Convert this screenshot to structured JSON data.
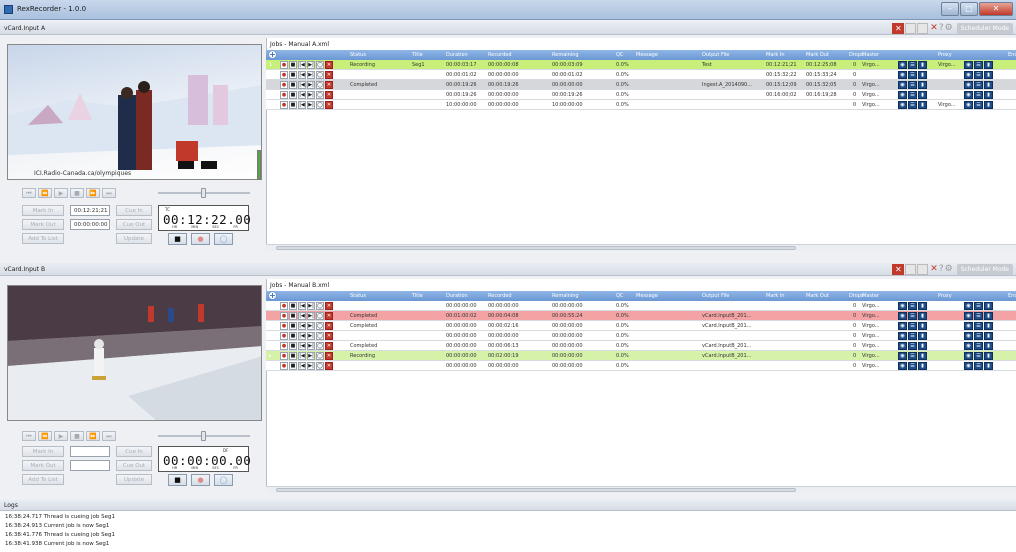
{
  "window": {
    "title": "RexRecorder - 1.0.0"
  },
  "panels": [
    {
      "header": "vCard.Input A",
      "scheduler_label": "Scheduler Mode",
      "preview_caption": "ICI.Radio-Canada.ca/olympiques",
      "transport": [
        "⏮",
        "⏪",
        "▶",
        "■",
        "⏩",
        "⏭"
      ],
      "mark_in_label": "Mark In",
      "mark_in_value": "00:12:21;21",
      "mark_out_label": "Mark Out",
      "mark_out_value": "00:00:00:00",
      "cue_in_label": "Cue In",
      "cue_out_label": "Cue Out",
      "add_to_list_label": "Add To List",
      "update_label": "Update",
      "timecode_tag": "TC",
      "timecode": "00:12:22.00",
      "timecode_units": [
        "HR",
        "MIN",
        "SEC",
        "FR"
      ],
      "jobs_title": "Jobs - Manual A.xml",
      "columns": [
        "Status",
        "Title",
        "Duration",
        "Recorded",
        "Remaining",
        "QC",
        "Message",
        "Output File",
        "Mark In",
        "Mark Out",
        "Drops",
        "Master",
        "Proxy",
        "Enc"
      ],
      "rows": [
        {
          "idx": "1",
          "status": "Recording",
          "title": "Seg1",
          "duration": "00:00:03:17",
          "recorded": "00:00:00:08",
          "remaining": "00:00:03:09",
          "qc": "0.0%",
          "message": "",
          "output": "Test",
          "mark_in": "00:12:21;21",
          "mark_out": "00:12:25;08",
          "drops": "0",
          "master": "Virgo...",
          "proxy": "Virgo...",
          "bg": "#c8ef7a"
        },
        {
          "idx": "",
          "status": "",
          "title": "",
          "duration": "00:00:01:02",
          "recorded": "00:00:00:00",
          "remaining": "00:00:01:02",
          "qc": "0.0%",
          "message": "",
          "output": "",
          "mark_in": "00:15:32;22",
          "mark_out": "00:15:33;24",
          "drops": "0",
          "master": "",
          "proxy": "",
          "bg": "#ffffff"
        },
        {
          "idx": "",
          "status": "Completed",
          "title": "",
          "duration": "00:00:19:26",
          "recorded": "00:00:19:26",
          "remaining": "00:00:00:00",
          "qc": "0.0%",
          "message": "",
          "output": "Ingest.A_2014090...",
          "mark_in": "00:15:12;09",
          "mark_out": "00:15:32;05",
          "drops": "0",
          "master": "Virgo...",
          "proxy": "",
          "bg": "#d5d7da"
        },
        {
          "idx": "",
          "status": "",
          "title": "",
          "duration": "00:00:19:26",
          "recorded": "00:00:00:00",
          "remaining": "00:00:19:26",
          "qc": "0.0%",
          "message": "",
          "output": "",
          "mark_in": "00:16:00;02",
          "mark_out": "00:16:19;28",
          "drops": "0",
          "master": "Virgo...",
          "proxy": "",
          "bg": "#ffffff"
        },
        {
          "idx": "",
          "status": "",
          "title": "",
          "duration": "10:00:00:00",
          "recorded": "00:00:00:00",
          "remaining": "10:00:00:00",
          "qc": "0.0%",
          "message": "",
          "output": "",
          "mark_in": "",
          "mark_out": "",
          "drops": "0",
          "master": "Virgo...",
          "proxy": "Virgo...",
          "bg": "#ffffff"
        }
      ]
    },
    {
      "header": "vCard.Input B",
      "scheduler_label": "Scheduler Mode",
      "preview_caption": "",
      "transport": [
        "⏮",
        "⏪",
        "▶",
        "■",
        "⏩",
        "⏭"
      ],
      "mark_in_label": "Mark In",
      "mark_in_value": "",
      "mark_out_label": "Mark Out",
      "mark_out_value": "",
      "cue_in_label": "Cue In",
      "cue_out_label": "Cue Out",
      "add_to_list_label": "Add To List",
      "update_label": "Update",
      "timecode_tag": "DF",
      "timecode": "00:00:00.00",
      "timecode_units": [
        "HR",
        "MIN",
        "SEC",
        "FR"
      ],
      "jobs_title": "Jobs - Manual B.xml",
      "columns": [
        "Status",
        "Title",
        "Duration",
        "Recorded",
        "Remaining",
        "QC",
        "Message",
        "Output File",
        "Mark In",
        "Mark Out",
        "Drops",
        "Master",
        "Proxy",
        "Enc"
      ],
      "rows": [
        {
          "idx": "",
          "status": "",
          "title": "",
          "duration": "00:00:00:00",
          "recorded": "00:00:00:00",
          "remaining": "00:00:00:00",
          "qc": "0.0%",
          "message": "",
          "output": "",
          "mark_in": "",
          "mark_out": "",
          "drops": "0",
          "master": "Virgo...",
          "proxy": "",
          "bg": "#ffffff"
        },
        {
          "idx": "",
          "status": "Completed",
          "title": "",
          "duration": "00:01:00:02",
          "recorded": "00:00:04:08",
          "remaining": "00:00:55:24",
          "qc": "0.0%",
          "message": "",
          "output": "vCard.InputB_201...",
          "mark_in": "",
          "mark_out": "",
          "drops": "0",
          "master": "Virgo...",
          "proxy": "",
          "bg": "#f3a3a3"
        },
        {
          "idx": "",
          "status": "Completed",
          "title": "",
          "duration": "00:00:00:00",
          "recorded": "00:00:02:16",
          "remaining": "00:00:00:00",
          "qc": "0.0%",
          "message": "",
          "output": "vCard.InputB_201...",
          "mark_in": "",
          "mark_out": "",
          "drops": "0",
          "master": "Virgo...",
          "proxy": "",
          "bg": "#ffffff"
        },
        {
          "idx": "",
          "status": "",
          "title": "",
          "duration": "00:00:00:00",
          "recorded": "00:00:00:00",
          "remaining": "00:00:00:00",
          "qc": "0.0%",
          "message": "",
          "output": "",
          "mark_in": "",
          "mark_out": "",
          "drops": "0",
          "master": "Virgo...",
          "proxy": "",
          "bg": "#ffffff"
        },
        {
          "idx": "",
          "status": "Completed",
          "title": "",
          "duration": "00:00:00:00",
          "recorded": "00:00:06:13",
          "remaining": "00:00:00:00",
          "qc": "0.0%",
          "message": "",
          "output": "vCard.InputB_201...",
          "mark_in": "",
          "mark_out": "",
          "drops": "0",
          "master": "Virgo...",
          "proxy": "",
          "bg": "#ffffff"
        },
        {
          "idx": "▸",
          "status": "Recording",
          "title": "",
          "duration": "00:00:00:00",
          "recorded": "00:02:00:19",
          "remaining": "00:00:00:00",
          "qc": "0.0%",
          "message": "",
          "output": "vCard.InputB_201...",
          "mark_in": "",
          "mark_out": "",
          "drops": "0",
          "master": "Virgo...",
          "proxy": "",
          "bg": "#d6f2a8"
        },
        {
          "idx": "",
          "status": "",
          "title": "",
          "duration": "00:00:00:00",
          "recorded": "00:00:00:00",
          "remaining": "00:00:00:00",
          "qc": "0.0%",
          "message": "",
          "output": "",
          "mark_in": "",
          "mark_out": "",
          "drops": "0",
          "master": "Virgo...",
          "proxy": "",
          "bg": "#ffffff"
        }
      ]
    }
  ],
  "logs": {
    "header": "Logs",
    "lines": [
      "16:38:24.717 Thread is cueing job Seg1",
      "16:38:24.913 Current job is now Seg1",
      "16:38:41.776 Thread is cueing job Seg1",
      "16:38:41.938 Current job is now Seg1"
    ]
  }
}
